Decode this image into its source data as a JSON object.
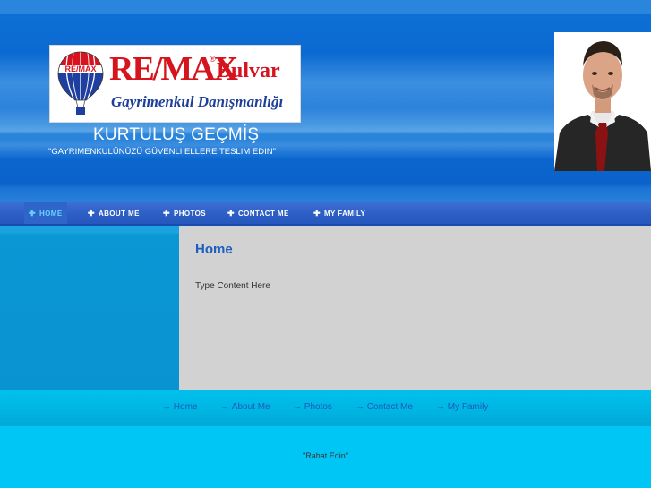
{
  "header": {
    "logo": {
      "brand": "RE/MAX",
      "brand_suffix": "Bulvar",
      "registered": "®",
      "tagline": "Gayrimenkul Danışmanlığı",
      "balloon_text": "RE/MAX"
    },
    "agent_name": "KURTULUŞ GEÇMİŞ",
    "slogan": "\"GAYRIMENKULÜNÜZÜ GÜVENLI ELLERE TESLIM EDIN\""
  },
  "nav": {
    "items": [
      {
        "label": "HOME",
        "active": true
      },
      {
        "label": "ABOUT ME",
        "active": false
      },
      {
        "label": "PHOTOS",
        "active": false
      },
      {
        "label": "CONTACT ME",
        "active": false
      },
      {
        "label": "MY FAMILY",
        "active": false
      }
    ],
    "icon": "plus-icon",
    "icon_glyph": "✚"
  },
  "main": {
    "title": "Home",
    "body": "Type Content Here"
  },
  "footer_nav": {
    "icon": "arrow-right-icon",
    "icon_glyph": "→",
    "items": [
      {
        "label": "Home"
      },
      {
        "label": "About Me"
      },
      {
        "label": "Photos"
      },
      {
        "label": "Contact Me"
      },
      {
        "label": "My Family"
      }
    ]
  },
  "footer": {
    "text": "\"Rahat Edin\""
  },
  "colors": {
    "header_blue": "#0b6ad1",
    "nav_blue": "#2e5fc6",
    "nav_active_text": "#68d3ff",
    "content_bg": "#d2d2d2",
    "title_blue": "#1a5fbf",
    "footer_cyan": "#00c6f5",
    "remax_red": "#d6141e"
  }
}
